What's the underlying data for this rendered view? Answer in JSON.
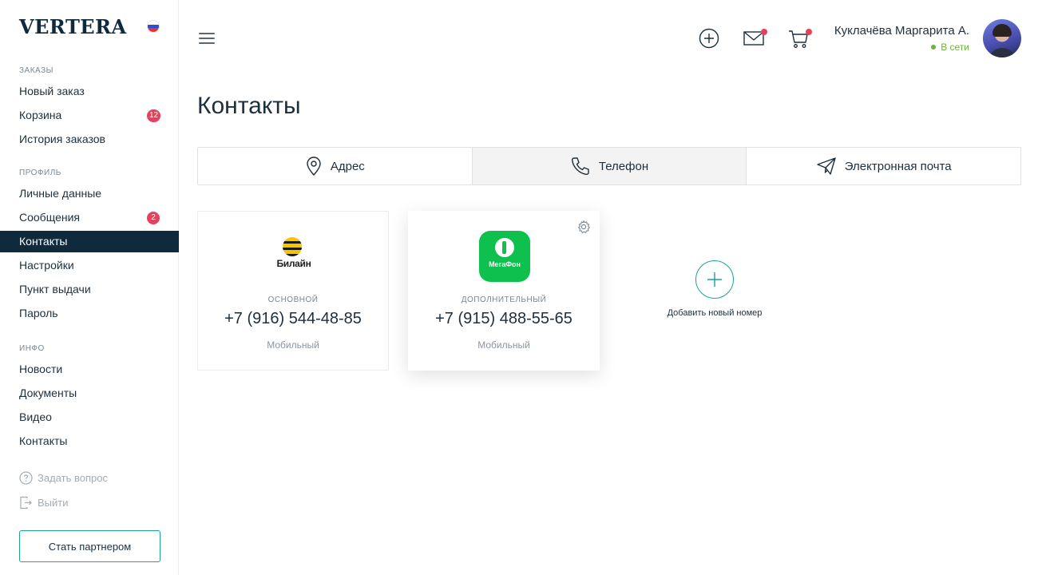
{
  "brand": {
    "logo_text": "VERTERA",
    "flag_icon": "russia-flag-icon"
  },
  "sidebar": {
    "sections": [
      {
        "title": "ЗАКАЗЫ",
        "items": [
          {
            "label": "Новый заказ"
          },
          {
            "label": "Корзина",
            "badge": "12"
          },
          {
            "label": "История заказов"
          }
        ]
      },
      {
        "title": "ПРОФИЛЬ",
        "items": [
          {
            "label": "Личные данные"
          },
          {
            "label": "Сообщения",
            "badge": "2"
          },
          {
            "label": "Контакты",
            "active": true
          },
          {
            "label": "Настройки"
          },
          {
            "label": "Пункт выдачи"
          },
          {
            "label": "Пароль"
          }
        ]
      },
      {
        "title": "ИНФО",
        "items": [
          {
            "label": "Новости"
          },
          {
            "label": "Документы"
          },
          {
            "label": "Видео"
          },
          {
            "label": "Контакты"
          }
        ]
      }
    ],
    "ask_question": "Задать вопрос",
    "logout": "Выйти",
    "partner_button": "Стать партнером"
  },
  "header": {
    "icons": [
      "menu-icon",
      "add-circle-icon",
      "mail-icon",
      "cart-icon"
    ],
    "user_name": "Куклачёва Маргарита А.",
    "user_status": "В сети",
    "notification_color": "#e8405b",
    "status_color": "#6fb13a"
  },
  "page": {
    "title": "Контакты",
    "tabs": [
      {
        "label": "Адрес",
        "icon": "location-pin-icon"
      },
      {
        "label": "Телефон",
        "icon": "phone-icon",
        "active": true
      },
      {
        "label": "Электронная почта",
        "icon": "paper-plane-icon"
      }
    ],
    "phones": [
      {
        "operator_logo": "Билайн",
        "type": "ОСНОВНОЙ",
        "number": "+7 (916) 544-48-85",
        "kind": "Мобильный"
      },
      {
        "operator_logo": "МегаФон",
        "type": "ДОПОЛНИТЕЛЬНЫЙ",
        "number": "+7 (915) 488-55-65",
        "kind": "Мобильный"
      }
    ],
    "add_number_label": "Добавить новый номер",
    "accent_color": "#1aa394",
    "sidebar_active_color": "#102a3d"
  }
}
